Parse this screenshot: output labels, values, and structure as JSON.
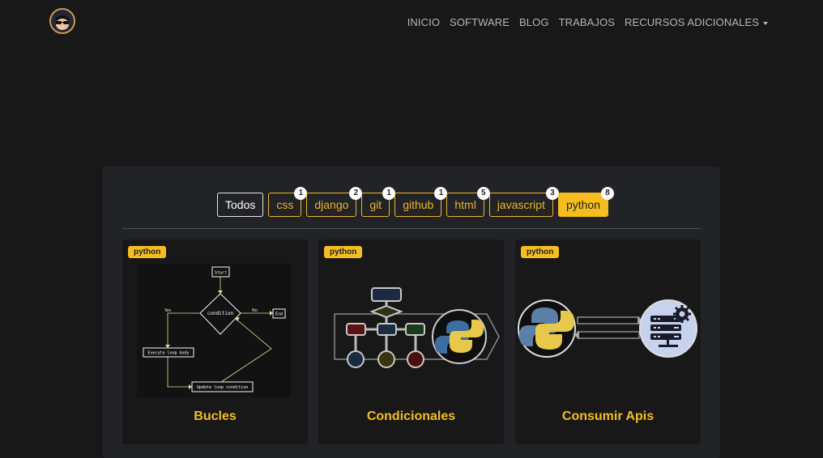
{
  "nav": {
    "links": [
      "INICIO",
      "SOFTWARE",
      "BLOG",
      "TRABAJOS",
      "RECURSOS ADICIONALES"
    ]
  },
  "filters": {
    "todos": "Todos",
    "items": [
      {
        "label": "css",
        "count": "1"
      },
      {
        "label": "django",
        "count": "2"
      },
      {
        "label": "git",
        "count": "1"
      },
      {
        "label": "github",
        "count": "1"
      },
      {
        "label": "html",
        "count": "5"
      },
      {
        "label": "javascript",
        "count": "3"
      },
      {
        "label": "python",
        "count": "8"
      }
    ],
    "active": "python"
  },
  "cards": [
    {
      "tag": "python",
      "title": "Bucles",
      "flow": {
        "start": "Start",
        "condition": "condition",
        "yes": "Yes",
        "no": "No",
        "end": "End",
        "body": "Execute loop body",
        "update": "Update loop condition"
      }
    },
    {
      "tag": "python",
      "title": "Condicionales"
    },
    {
      "tag": "python",
      "title": "Consumir Apis"
    }
  ],
  "colors": {
    "accent": "#f5bd1f",
    "background": "#181818",
    "panel": "#212327"
  }
}
